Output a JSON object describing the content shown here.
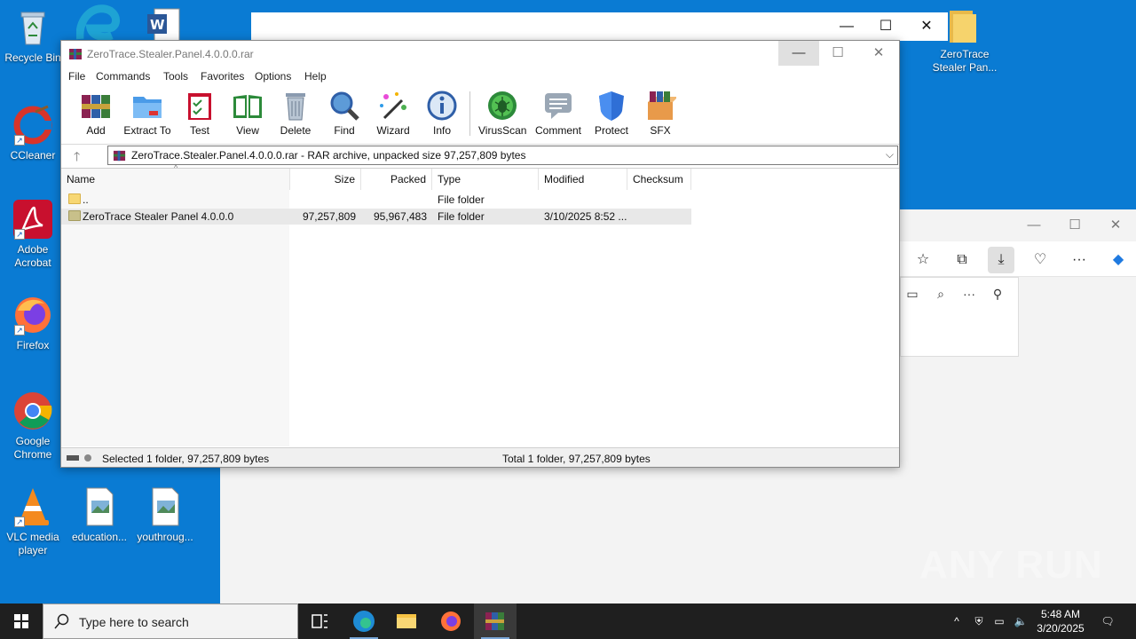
{
  "desktop": {
    "icons": [
      {
        "label": "Recycle Bin"
      },
      {
        "label": "CCleaner"
      },
      {
        "label": "Adobe Acrobat"
      },
      {
        "label": "Firefox"
      },
      {
        "label": "Google Chrome"
      },
      {
        "label": "VLC media player"
      },
      {
        "label": "education..."
      },
      {
        "label": "youthroug..."
      },
      {
        "label": "ZeroTrace Stealer Pan..."
      }
    ]
  },
  "winrar": {
    "title": "ZeroTrace.Stealer.Panel.4.0.0.0.rar",
    "menu": [
      "File",
      "Commands",
      "Tools",
      "Favorites",
      "Options",
      "Help"
    ],
    "toolbar": [
      "Add",
      "Extract To",
      "Test",
      "View",
      "Delete",
      "Find",
      "Wizard",
      "Info",
      "VirusScan",
      "Comment",
      "Protect",
      "SFX"
    ],
    "path": "ZeroTrace.Stealer.Panel.4.0.0.0.rar - RAR archive, unpacked size 97,257,809 bytes",
    "columns": [
      "Name",
      "Size",
      "Packed",
      "Type",
      "Modified",
      "Checksum"
    ],
    "rows": [
      {
        "name": "..",
        "size": "",
        "packed": "",
        "type": "File folder",
        "modified": ""
      },
      {
        "name": "ZeroTrace Stealer Panel 4.0.0.0",
        "size": "97,257,809",
        "packed": "95,967,483",
        "type": "File folder",
        "modified": "3/10/2025 8:52 ..."
      }
    ],
    "status_left": "Selected 1 folder, 97,257,809 bytes",
    "status_right": "Total 1 folder, 97,257,809 bytes"
  },
  "taskbar": {
    "search_placeholder": "Type here to search",
    "time": "5:48 AM",
    "date": "3/20/2025"
  },
  "watermark": "ANY RUN"
}
